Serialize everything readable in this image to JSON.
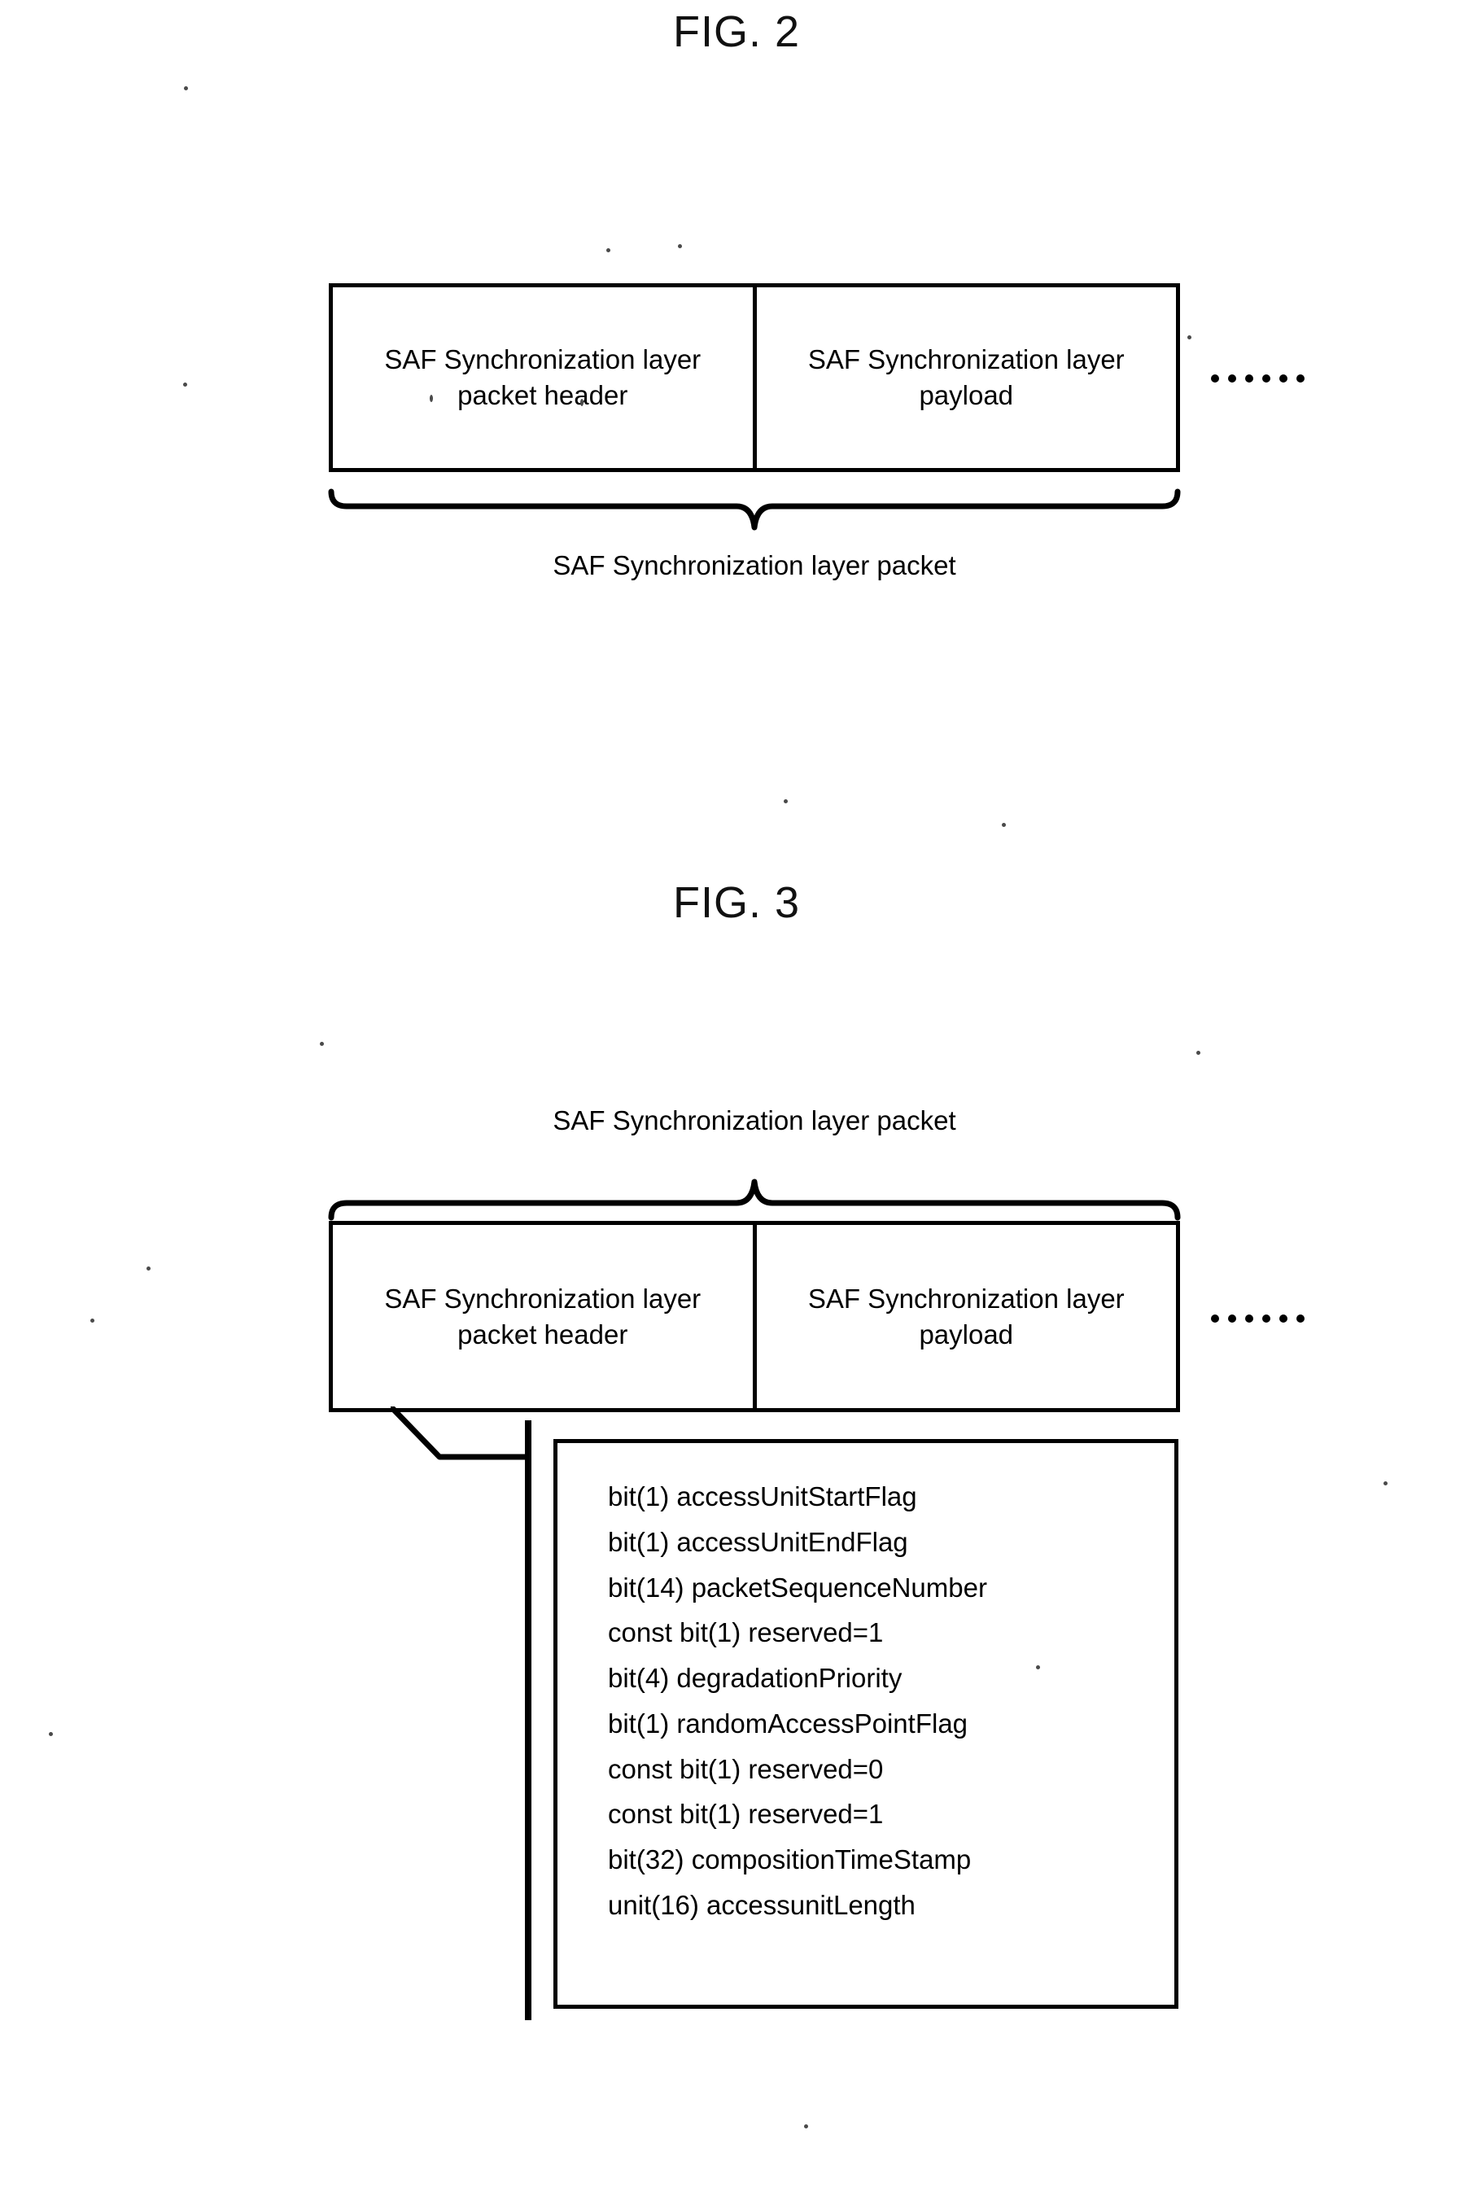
{
  "figures": [
    {
      "title": "FIG. 2",
      "packet_cells": [
        {
          "line1": "SAF Synchronization layer",
          "line2": "packet header"
        },
        {
          "line1": "SAF Synchronization layer",
          "line2": "payload"
        }
      ],
      "continuation_dots": "......",
      "brace_caption": "SAF Synchronization layer packet",
      "brace_position": "below"
    },
    {
      "title": "FIG. 3",
      "packet_cells": [
        {
          "line1": "SAF Synchronization layer",
          "line2": "packet header"
        },
        {
          "line1": "SAF Synchronization layer",
          "line2": "payload"
        }
      ],
      "continuation_dots": "......",
      "brace_caption": "SAF Synchronization layer packet",
      "brace_position": "above",
      "header_detail_fields": [
        "bit(1) accessUnitStartFlag",
        "bit(1) accessUnitEndFlag",
        "bit(14) packetSequenceNumber",
        "const bit(1) reserved=1",
        "bit(4) degradationPriority",
        "bit(1) randomAccessPointFlag",
        "const bit(1) reserved=0",
        "const bit(1) reserved=1",
        "bit(32) compositionTimeStamp",
        "unit(16) accessunitLength"
      ]
    }
  ],
  "colors": {
    "ink": "#000000",
    "paper": "#ffffff"
  }
}
